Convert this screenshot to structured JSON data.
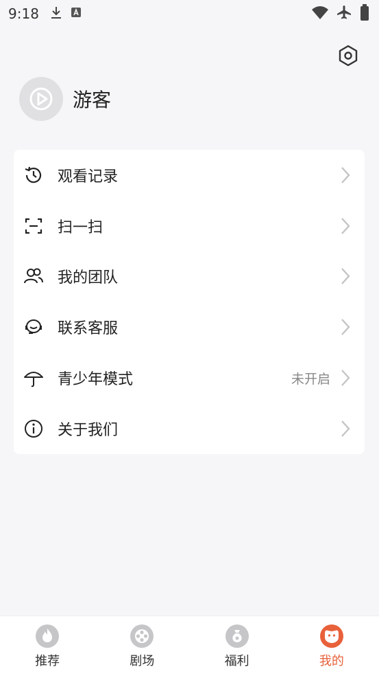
{
  "status_bar": {
    "time": "9:18"
  },
  "profile": {
    "username": "游客"
  },
  "menu": {
    "items": [
      {
        "label": "观看记录",
        "status": ""
      },
      {
        "label": "扫一扫",
        "status": ""
      },
      {
        "label": "我的团队",
        "status": ""
      },
      {
        "label": "联系客服",
        "status": ""
      },
      {
        "label": "青少年模式",
        "status": "未开启"
      },
      {
        "label": "关于我们",
        "status": ""
      }
    ]
  },
  "bottom_nav": {
    "items": [
      {
        "label": "推荐"
      },
      {
        "label": "剧场"
      },
      {
        "label": "福利"
      },
      {
        "label": "我的"
      }
    ],
    "active_index": 3
  },
  "colors": {
    "accent": "#e8613a",
    "background": "#f6f5f7",
    "icon_gray": "#c6c6c8"
  }
}
